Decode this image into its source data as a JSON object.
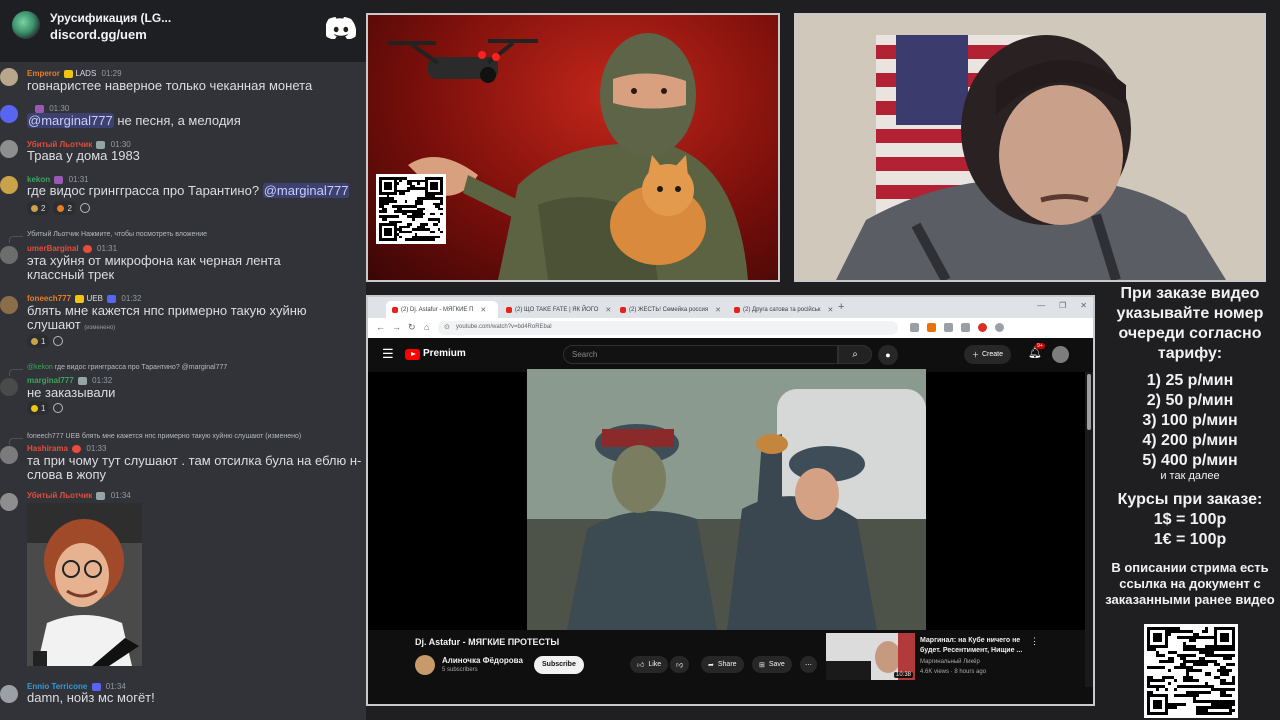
{
  "chat": {
    "server_title": "Уруcификация (LG...",
    "server_invite": "discord.gg/uem",
    "messages": [
      {
        "name": "Emperor",
        "name_color": "#e67e22",
        "badge": "LADS",
        "time": "01:29",
        "text": "говнаристее наверное только чеканная монета"
      },
      {
        "name": "",
        "time": "01:30",
        "mention": "@marginal777",
        "text": " не песня, а мелодия"
      },
      {
        "name": "Убитый Льотчик",
        "name_color": "#e74c3c",
        "time": "01:30",
        "text": "Трава у дома 1983"
      },
      {
        "name": "kekon",
        "name_color": "#3ba55c",
        "time": "01:31",
        "text": "где видос грингграсса про Тарантино? ",
        "mention": "@marginal777",
        "reactions": [
          "2",
          "2"
        ]
      },
      {
        "reply": "Убитый Льотчик  Нажмите, чтобы посмотреть вложение",
        "name": "umerBarginal",
        "name_color": "#e74c3c",
        "time": "01:31",
        "text": "эта хуйня от микрофона как черная лента классный трек"
      },
      {
        "name": "foneech777",
        "name_color": "#e67e22",
        "badge": "UEB",
        "time": "01:32",
        "text": "блять мне кажется нпс примерно такую хуйню слушают",
        "edited": "(изменено)",
        "reactions": [
          "1"
        ]
      },
      {
        "reply_name": "@kekon",
        "reply": "где видос грингграсса про Тарантино? @marginal777",
        "name": "marginal777",
        "name_color": "#3ba55c",
        "time": "01:32",
        "text": "не заказывали",
        "reactions": [
          "1"
        ]
      },
      {
        "reply": "foneech777  UEB  блять мне кажется нпс примерно такую хуйню слушают (изменено)",
        "name": "Hashirama",
        "name_color": "#e74c3c",
        "time": "01:33",
        "text": "та при чому тут слушают . там отсилка була на еблю н-слова в жопу"
      },
      {
        "name": "Убитый Льотчик",
        "name_color": "#e74c3c",
        "time": "01:34",
        "text": ""
      },
      {
        "name": "Ennio Terricone",
        "name_color": "#3498db",
        "time": "01:34",
        "text": "damn, нойз мс могёт!"
      }
    ]
  },
  "browser": {
    "tabs": [
      "(2) Dj. Astafur - МЯГКИЕ П",
      "(2) ЩО TAKE FATE | ЯК ЙОГО",
      "(2) ЖЕСТЬ! Семейка россия",
      "(2) Друга сатова та російськ"
    ],
    "url": "youtube.com/watch?v=bd4RoREbal",
    "search_placeholder": "Search",
    "premium_label": "Premium",
    "create_label": "Create",
    "notif_count": "9+",
    "video_title": "Dj. Astafur - МЯГКИЕ ПРОТЕСТЫ",
    "channel_name": "Алиночка Фёдорова",
    "channel_subs": "5 subscribers",
    "subscribe_label": "Subscribe",
    "like_label": "Like",
    "share_label": "Share",
    "save_label": "Save",
    "rec_title": "Маргинал: на Кубе ничего не будет. Ресентимент, Нищие ...",
    "rec_channel": "Маргинальный Ликёр",
    "rec_stats": "4.6K views · 8 hours ago",
    "rec_duration": "10:38"
  },
  "prices": {
    "intro": "При заказе видео указывайте номер очереди согласно тарифу:",
    "tariffs": [
      "1) 25 р/мин",
      "2) 50 р/мин",
      "3) 100 р/мин",
      "4) 200 р/мин",
      "5) 400 р/мин"
    ],
    "more": "и так далее",
    "rates_title": "Курсы при заказе:",
    "rates": [
      "1$ = 100р",
      "1€ = 100р"
    ],
    "description": "В описании стрима есть ссылка на документ с заказанными ранее видео"
  }
}
